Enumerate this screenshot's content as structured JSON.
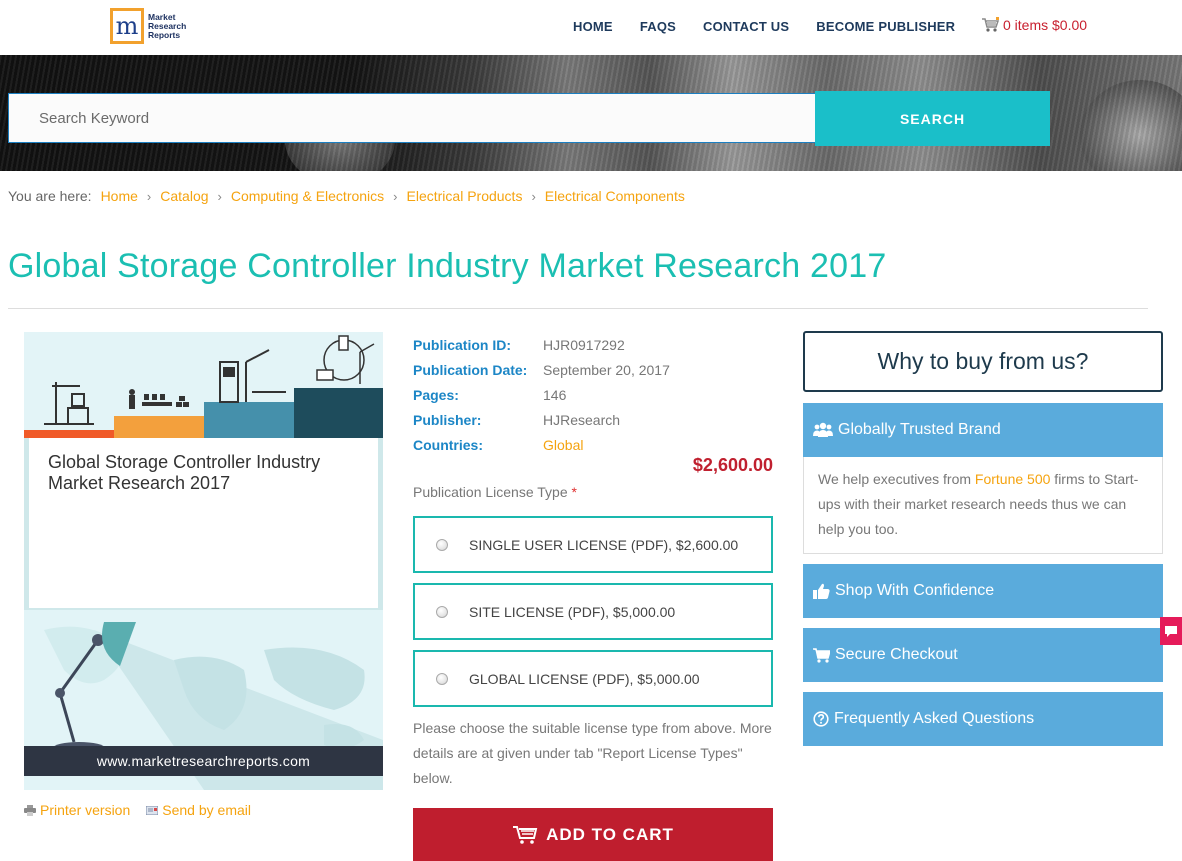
{
  "header": {
    "logo": {
      "letter": "m",
      "lines": [
        "Market",
        "Research",
        "Reports"
      ]
    },
    "nav": [
      {
        "label": "HOME"
      },
      {
        "label": "FAQS"
      },
      {
        "label": "CONTACT US"
      },
      {
        "label": "BECOME PUBLISHER"
      }
    ],
    "cart": {
      "icon": "shopping-cart-icon",
      "label": "0 items $0.00"
    }
  },
  "search": {
    "placeholder": "Search Keyword",
    "value": "",
    "button_label": "SEARCH"
  },
  "breadcrumb": {
    "prefix": "You are here:",
    "items": [
      "Home",
      "Catalog",
      "Computing & Electronics",
      "Electrical Products",
      "Electrical Components"
    ]
  },
  "page_title": "Global Storage Controller Industry Market Research 2017",
  "cover": {
    "title": "Global Storage Controller Industry Market Research 2017",
    "url": "www.marketresearchreports.com"
  },
  "utility_links": [
    {
      "icon": "printer-icon",
      "label": "Printer version"
    },
    {
      "icon": "email-icon",
      "label": "Send by email"
    }
  ],
  "details": [
    {
      "key": "Publication ID:",
      "value": "HJR0917292"
    },
    {
      "key": "Publication Date:",
      "value": "September 20, 2017"
    },
    {
      "key": "Pages:",
      "value": "146"
    },
    {
      "key": "Publisher:",
      "value": "HJResearch"
    },
    {
      "key": "Countries:",
      "value": "Global"
    }
  ],
  "price": "$2,600.00",
  "license": {
    "label": "Publication License Type",
    "required_mark": "*",
    "options": [
      {
        "label": "SINGLE USER LICENSE (PDF), $2,600.00",
        "selected": false
      },
      {
        "label": "SITE LICENSE (PDF), $5,000.00",
        "selected": false
      },
      {
        "label": "GLOBAL LICENSE (PDF), $5,000.00",
        "selected": false
      }
    ],
    "hint": "Please choose the suitable license type from above. More details are at given under tab \"Report License Types\" below."
  },
  "add_to_cart_label": "ADD TO CART",
  "sidebar": {
    "heading": "Why to buy from us?",
    "items": [
      {
        "icon": "users-icon",
        "label": "Globally Trusted Brand"
      },
      {
        "icon": "thumbs-up-icon",
        "label": "Shop With Confidence"
      },
      {
        "icon": "cart-icon",
        "label": "Secure Checkout"
      },
      {
        "icon": "question-circle-icon",
        "label": "Frequently Asked Questions"
      }
    ],
    "trusted_body": {
      "before": "We help executives from ",
      "highlight": "Fortune 500",
      "after": " firms to Start-ups with their market research needs thus we can help you too."
    }
  },
  "colors": {
    "accent_teal": "#1abfc9",
    "title_teal": "#1bbfb2",
    "link_orange": "#f5a30f",
    "price_red": "#c0202f",
    "label_blue": "#1c86c6",
    "sidebar_blue": "#5aabdc",
    "cart_button": "#bf1e2e",
    "chat_pink": "#e51b5a"
  }
}
